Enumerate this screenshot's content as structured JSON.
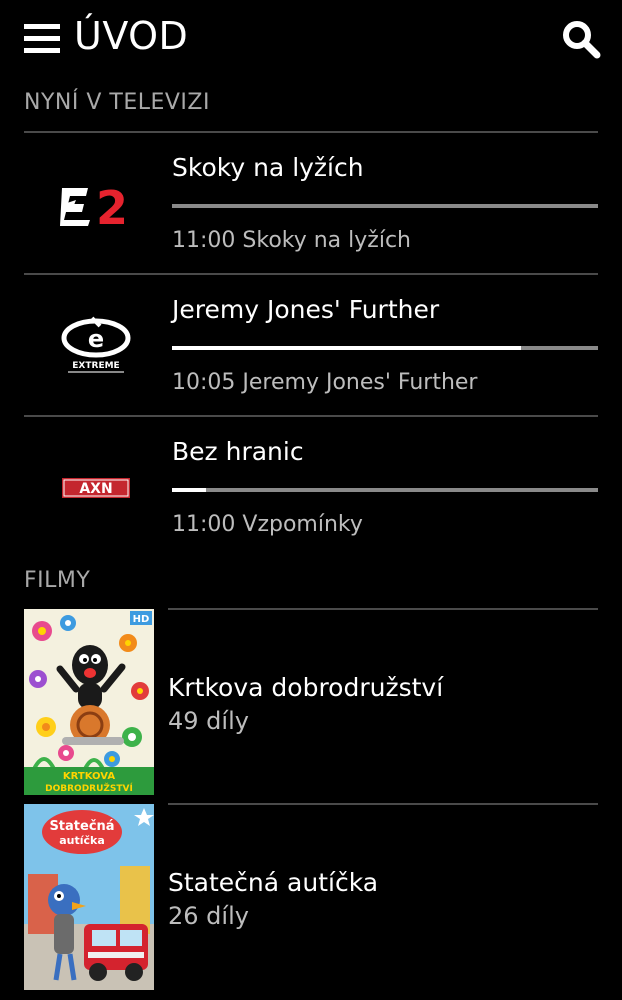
{
  "header": {
    "title": "ÚVOD",
    "menu_icon": "hamburger-menu-icon",
    "search_icon": "search-icon"
  },
  "now_on_tv": {
    "label": "NYNÍ V TELEVIZI",
    "channels": [
      {
        "logo": "E2",
        "logo_icon": "eurosport-2-logo",
        "title": "Skoky na lyžích",
        "subtitle": "11:00 Skoky na lyžích",
        "progress": 0.0
      },
      {
        "logo": "EXTREME",
        "logo_icon": "extreme-sports-channel-logo",
        "title": "Jeremy Jones' Further",
        "subtitle": "10:05 Jeremy Jones' Further",
        "progress": 0.82
      },
      {
        "logo": "AXN",
        "logo_icon": "axn-logo",
        "title": "Bez hranic",
        "subtitle": "11:00 Vzpomínky",
        "progress": 0.08
      }
    ]
  },
  "films": {
    "label": "FILMY",
    "items": [
      {
        "title": "Krtkova dobrodružství",
        "count": "49 díly",
        "poster_badge": "HD",
        "poster_caption_1": "KRTKOVA",
        "poster_caption_2": "DOBRODRUŽSTVÍ"
      },
      {
        "title": "Statečná autíčka",
        "count": "26 díly",
        "poster_caption_1": "Statečná",
        "poster_caption_2": "autíčka"
      }
    ]
  },
  "colors": {
    "background": "#000000",
    "text": "#ffffff",
    "muted": "#a9a9a9",
    "progress_track": "#8a8a8a",
    "divider": "#4a4a4a"
  }
}
